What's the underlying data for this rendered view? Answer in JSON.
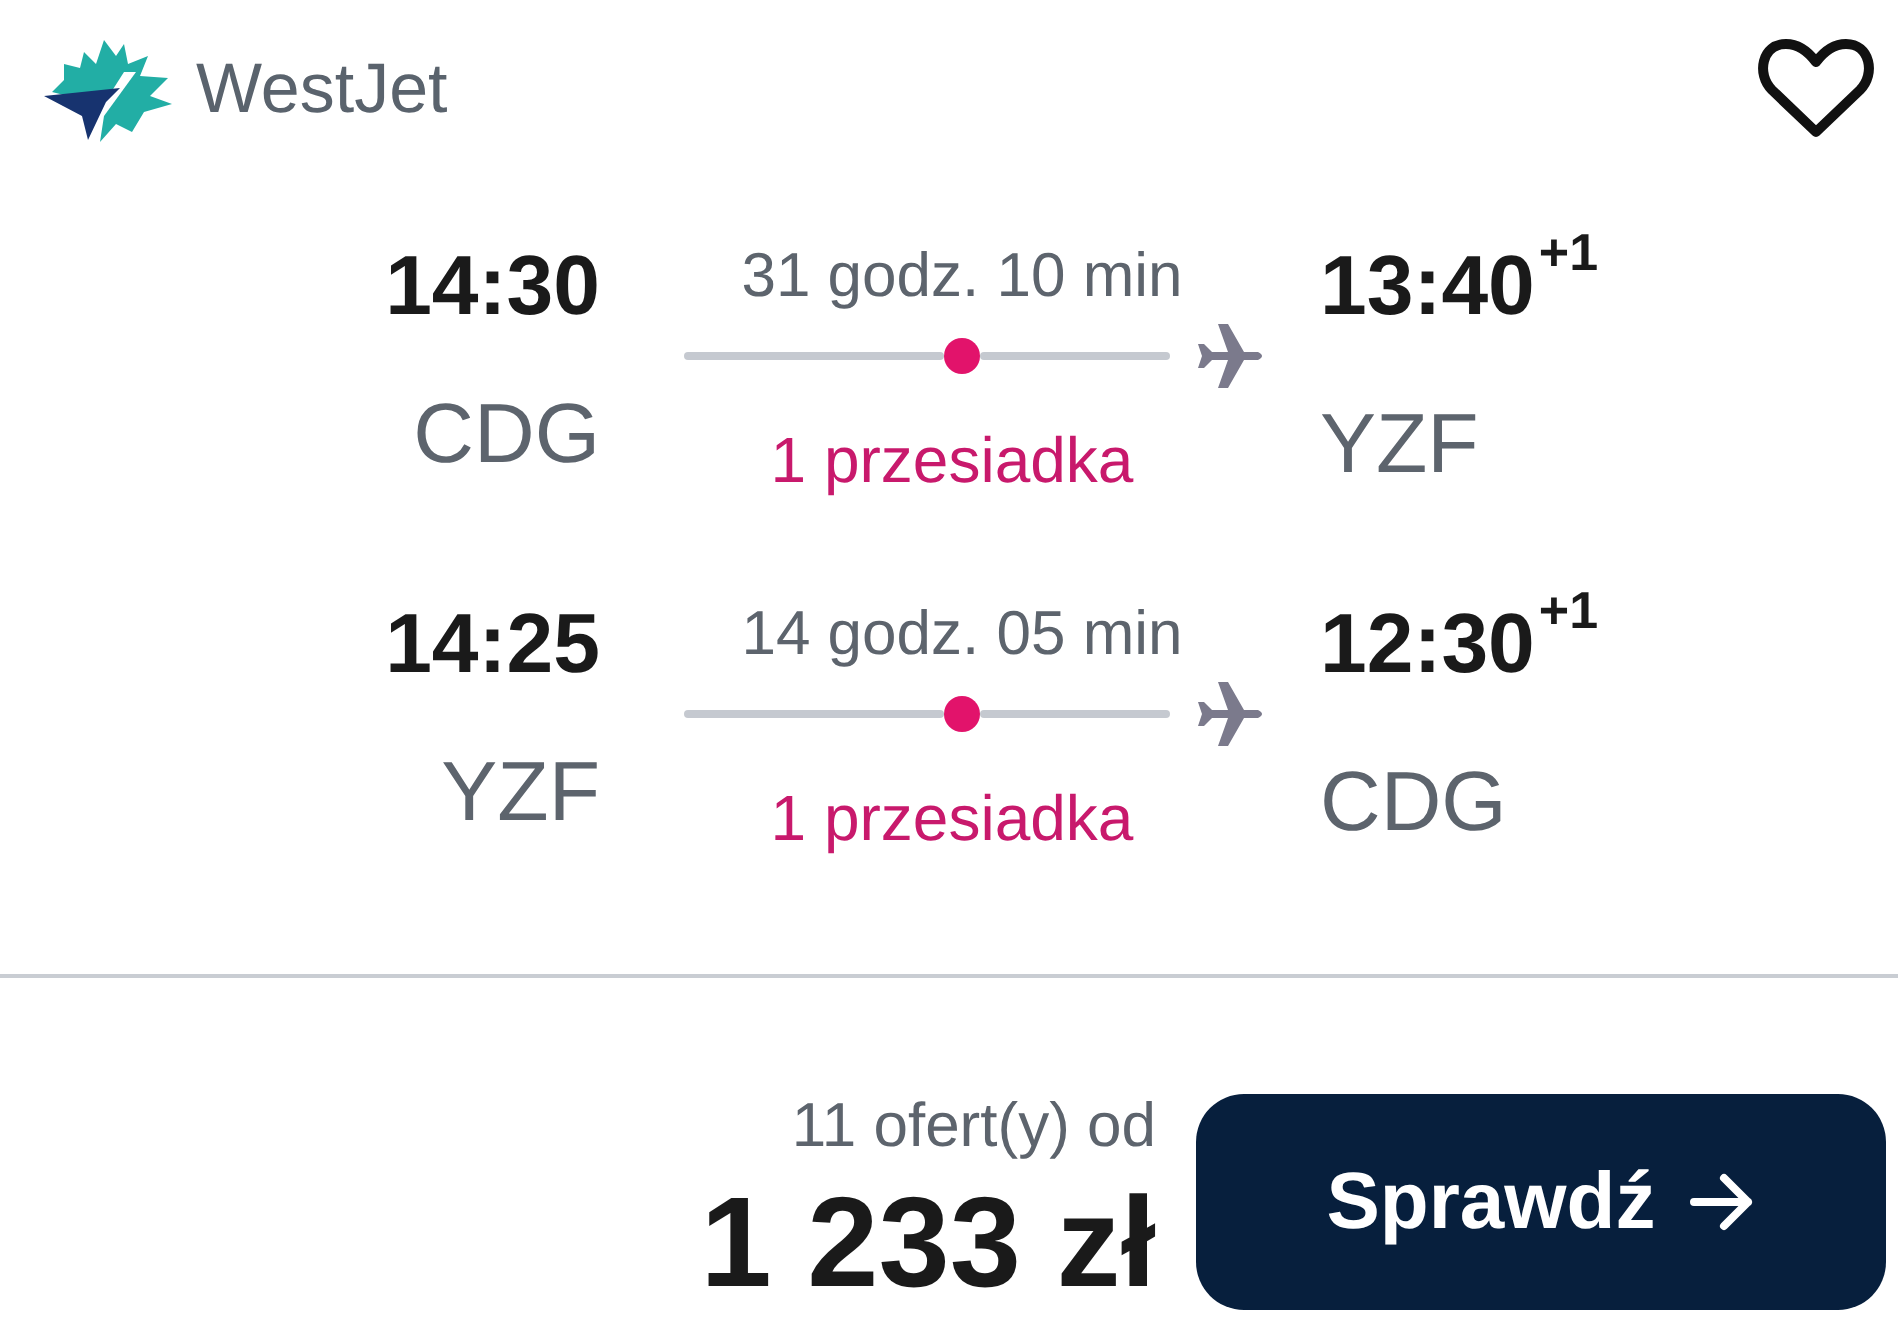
{
  "header": {
    "airline": "WestJet",
    "favorite": {
      "saved": false
    }
  },
  "legs": [
    {
      "departure_time": "14:30",
      "departure_airport": "CDG",
      "duration": "31 godz. 10 min",
      "stops": "1 przesiadka",
      "arrival_time": "13:40",
      "day_offset": "+1",
      "arrival_airport": "YZF"
    },
    {
      "departure_time": "14:25",
      "departure_airport": "YZF",
      "duration": "14 godz. 05 min",
      "stops": "1 przesiadka",
      "arrival_time": "12:30",
      "day_offset": "+1",
      "arrival_airport": "CDG"
    }
  ],
  "footer": {
    "offers": "11 ofert(y) od",
    "price": "1 233 zł",
    "button": "Sprawdź"
  }
}
